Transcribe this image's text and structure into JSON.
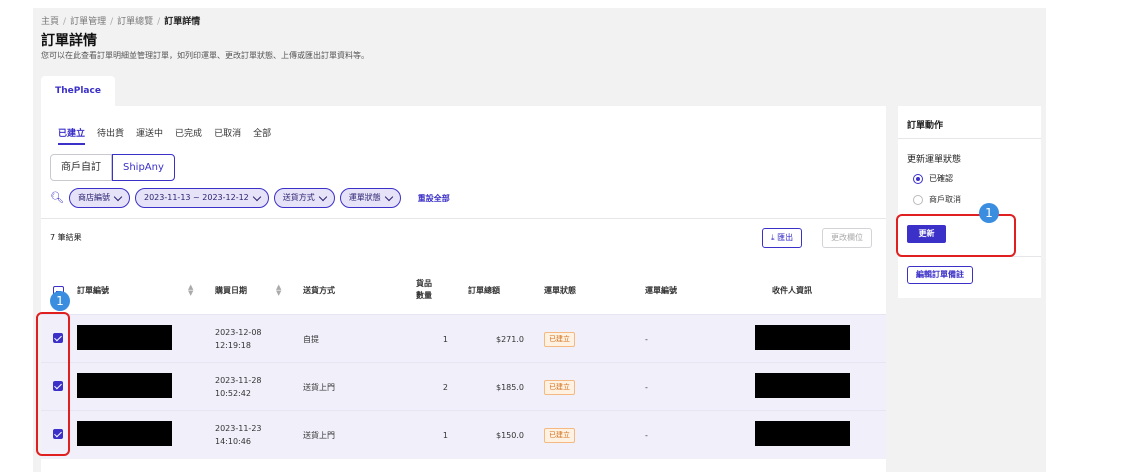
{
  "breadcrumb": [
    "主頁",
    "訂單管理",
    "訂單總覽",
    "訂單詳情"
  ],
  "breadcrumb_sep": "/",
  "page": {
    "title": "訂單詳情",
    "description": "您可以在此查看訂單明細並管理訂單，如列印運單、更改訂單狀態、上傳或匯出訂單資料等。"
  },
  "store_tab": "ThePlace",
  "status_tabs": [
    "已建立",
    "待出貨",
    "運送中",
    "已完成",
    "已取消",
    "全部"
  ],
  "source_toggle": [
    "商戶自訂",
    "ShipAny"
  ],
  "filters": [
    "商店編號",
    "2023-11-13 ~ 2023-12-12",
    "送貨方式",
    "運單狀態"
  ],
  "reset_label": "重設全部",
  "result_count": "7 筆結果",
  "export_label": "匯出",
  "export_icon": "⤓",
  "columns_label": "更改欄位",
  "table": {
    "headers": [
      "訂單編號",
      "購買日期",
      "送貨方式",
      "貨品數量",
      "訂單總額",
      "運單狀態",
      "運單編號",
      "收件人資訊"
    ],
    "rows": [
      {
        "date": "2023-12-08",
        "time": "12:19:18",
        "method": "自提",
        "qty": "1",
        "total": "$271.0",
        "status": "已建立",
        "waybill": "-"
      },
      {
        "date": "2023-11-28",
        "time": "10:52:42",
        "method": "送貨上門",
        "qty": "2",
        "total": "$185.0",
        "status": "已建立",
        "waybill": "-"
      },
      {
        "date": "2023-11-23",
        "time": "14:10:46",
        "method": "送貨上門",
        "qty": "1",
        "total": "$150.0",
        "status": "已建立",
        "waybill": "-"
      }
    ]
  },
  "side_panel": {
    "title": "訂單動作",
    "section_label": "更新運單狀態",
    "options": [
      "已確認",
      "商戶取消"
    ],
    "selected": "已確認",
    "update_button": "更新",
    "note_button": "編輯訂單備註"
  },
  "annotations": [
    "1",
    "1"
  ],
  "colors": {
    "accent": "#3b30c8",
    "highlight": "#e02020",
    "marker": "#3b8de0",
    "badge": "#d26b14"
  }
}
